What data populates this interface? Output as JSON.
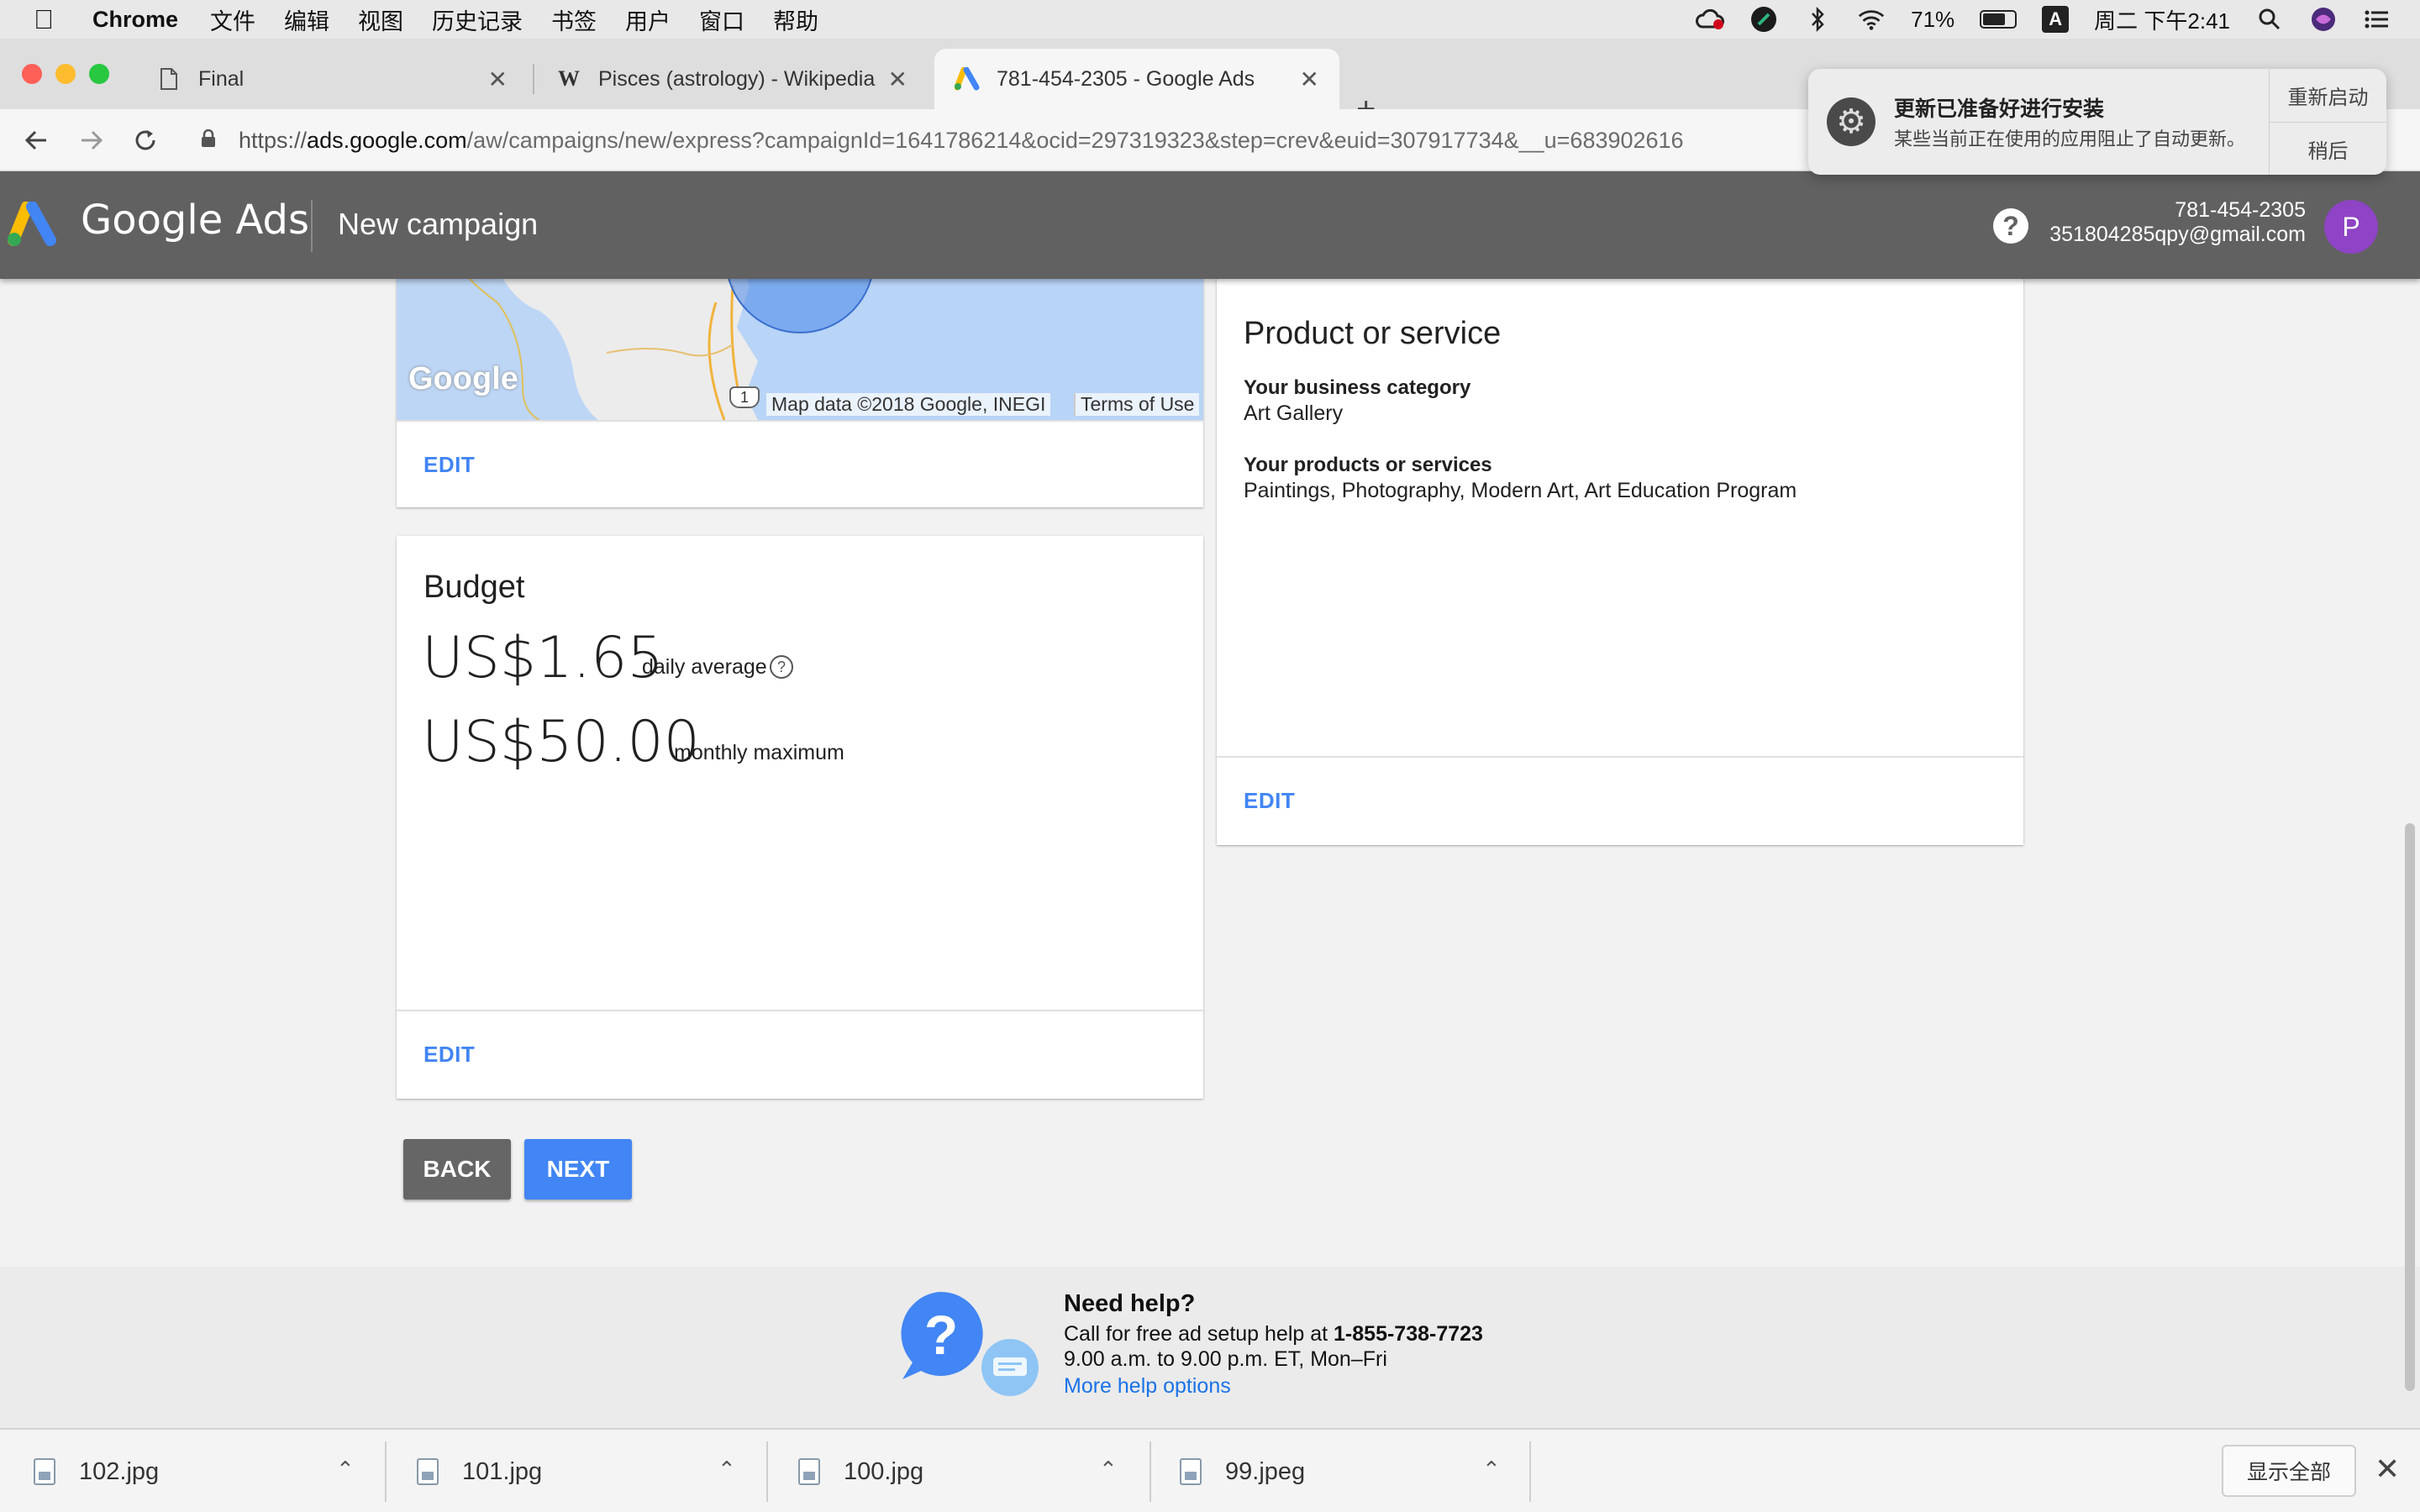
{
  "menubar": {
    "app_name": "Chrome",
    "items": [
      "文件",
      "编辑",
      "视图",
      "历史记录",
      "书签",
      "用户",
      "窗口",
      "帮助"
    ],
    "battery": "71%",
    "battery_level": 0.71,
    "clock": "周二 下午2:41",
    "input_method": "A"
  },
  "tabs": [
    {
      "title": "Final",
      "icon": "document-icon"
    },
    {
      "title": "Pisces (astrology) - Wikipedia",
      "icon": "wikipedia-icon",
      "icon_text": "W"
    },
    {
      "title": "781-454-2305 - Google Ads",
      "icon": "google-ads-icon",
      "active": true
    }
  ],
  "address_bar": {
    "scheme": "https://",
    "host": "ads.google.com",
    "path": "/aw/campaigns/new/express?campaignId=1641786214&ocid=297319323&step=crev&euid=307917734&__u=68390261​6"
  },
  "notification": {
    "title": "更新已准备好进行安装",
    "body": "某些当前正在使用的应用阻止了自动更新。",
    "restart_label": "重新启动",
    "later_label": "稍后"
  },
  "ads_header": {
    "brand": "Google Ads",
    "page_title": "New campaign",
    "help_icon": "?",
    "account_phone": "781-454-2305",
    "account_email": "351804285qpy@gmail.com",
    "avatar_letter": "P"
  },
  "map_card": {
    "google_logo": "Google",
    "route_shield": "1",
    "map_data": "Map data ©2018 Google, INEGI",
    "terms": "Terms of Use",
    "edit_label": "EDIT"
  },
  "budget_card": {
    "title": "Budget",
    "daily_amount": "US$1.65",
    "daily_note": "daily average",
    "monthly_amount": "US$50.00",
    "monthly_note": "monthly maximum",
    "edit_label": "EDIT"
  },
  "product_card": {
    "title": "Product or service",
    "category_label": "Your business category",
    "category_value": "Art Gallery",
    "products_label": "Your products or services",
    "products_value": "Paintings, Photography, Modern Art, Art Education Program",
    "edit_label": "EDIT"
  },
  "actions": {
    "back_label": "BACK",
    "next_label": "NEXT"
  },
  "help_section": {
    "title": "Need help?",
    "call_text": "Call for free ad setup help at ",
    "phone": "1-855-738-7723",
    "hours": "9.00 a.m. to 9.00 p.m. ET, Mon–Fri",
    "more_link": "More help options"
  },
  "downloads": {
    "files": [
      "102.jpg",
      "101.jpg",
      "100.jpg",
      "99.jpeg"
    ],
    "show_all_label": "显示全部"
  },
  "colors": {
    "accent_blue": "#4285f4",
    "header_gray": "#616161",
    "back_button": "#666666",
    "avatar": "#8e44c4"
  }
}
